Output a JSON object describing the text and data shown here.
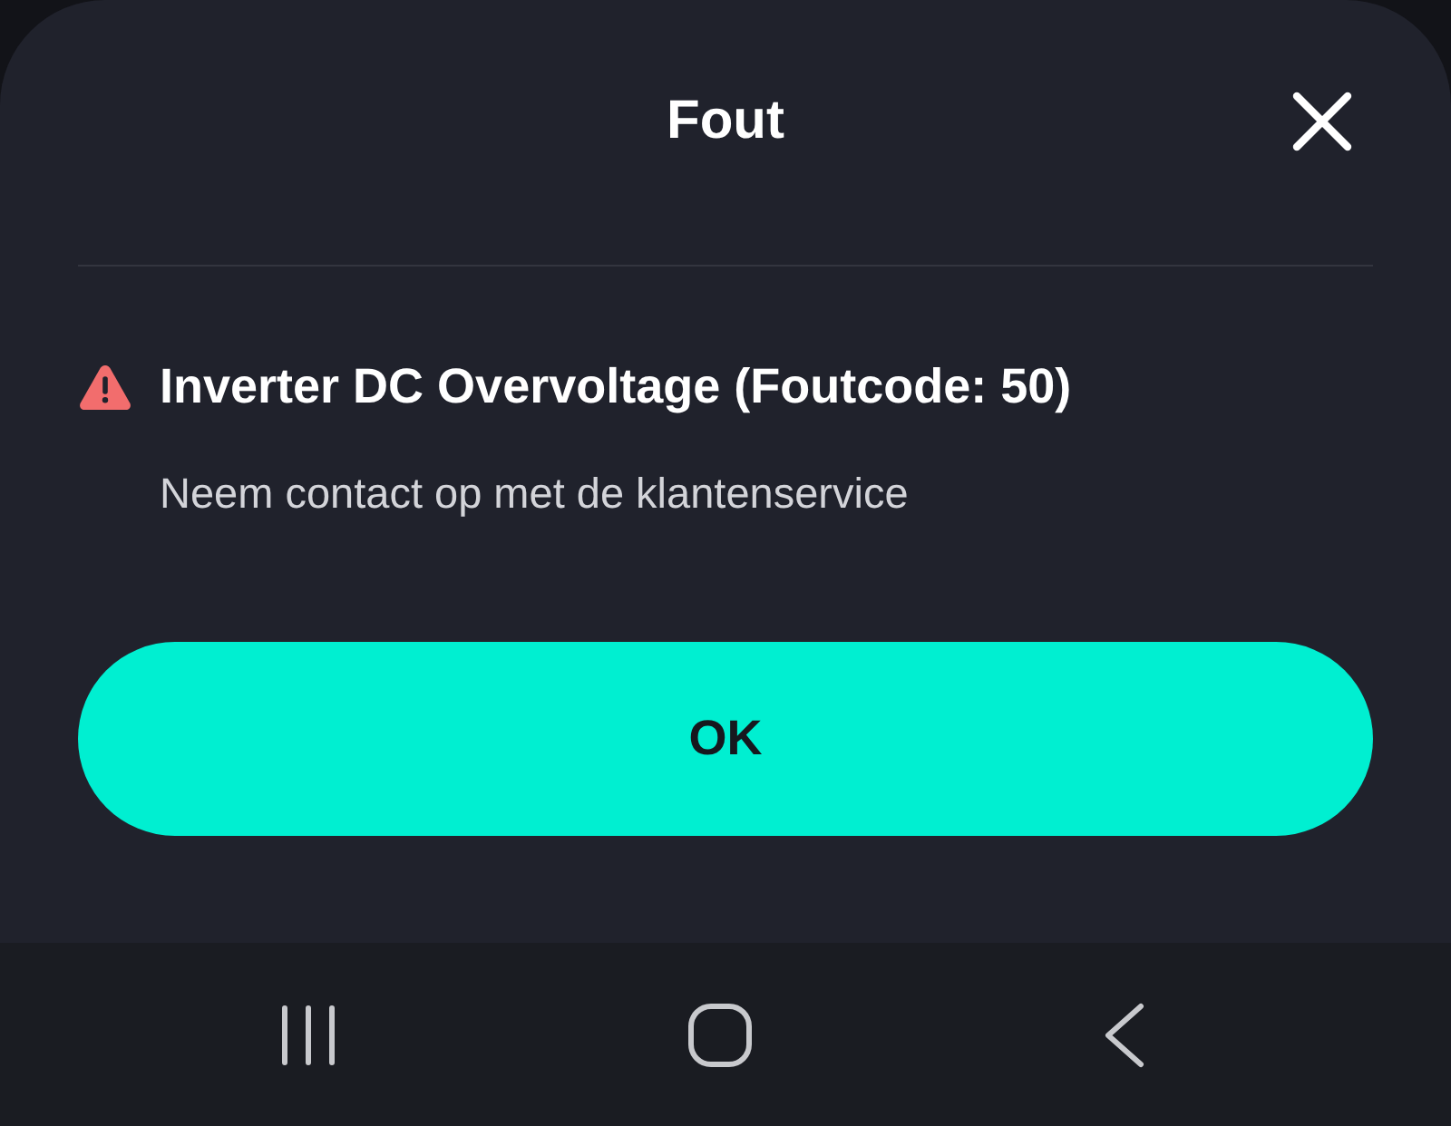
{
  "dialog": {
    "title": "Fout"
  },
  "message": {
    "kind": "error",
    "title": "Inverter DC Overvoltage (Foutcode: 50)",
    "body": "Neem contact op met de klantenservice"
  },
  "buttons": [
    {
      "label": "OK",
      "kind": "primary"
    }
  ]
}
